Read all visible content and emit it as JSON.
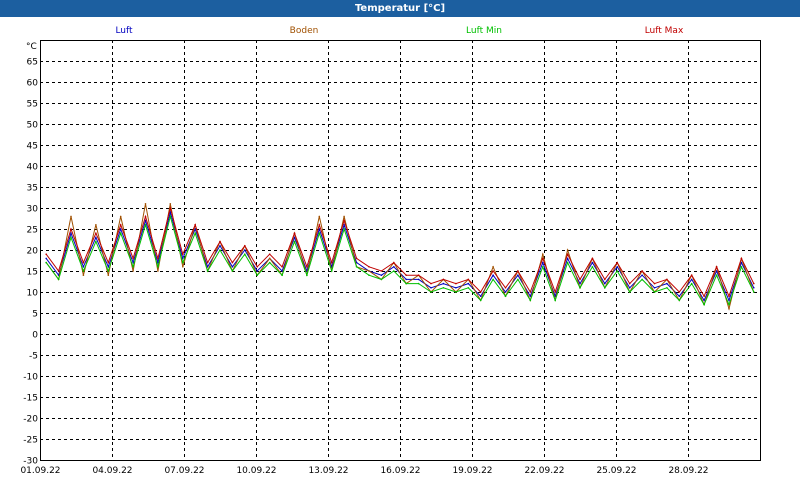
{
  "window": {
    "title": "Temperatur [°C]"
  },
  "chart_data": {
    "type": "line",
    "ylabel": "°C",
    "ylim": [
      -30,
      70
    ],
    "yticks": [
      65,
      60,
      55,
      50,
      45,
      40,
      35,
      30,
      25,
      20,
      15,
      10,
      5,
      0,
      -5,
      -10,
      -15,
      -20,
      -25,
      -30
    ],
    "xlim": [
      "01.09.22 00:00",
      "30.09.22 24:00"
    ],
    "xticks": [
      "01.09.22",
      "04.09.22",
      "07.09.22",
      "10.09.22",
      "13.09.22",
      "16.09.22",
      "19.09.22",
      "22.09.22",
      "25.09.22",
      "28.09.22"
    ],
    "grid": true,
    "legend_position": "top",
    "series": [
      {
        "name": "Luft",
        "color": "#0000c0",
        "values": [
          18,
          14,
          24,
          16,
          23,
          16,
          25,
          17,
          27,
          17,
          29,
          18,
          25,
          16,
          21,
          16,
          20,
          15,
          18,
          15,
          23,
          15,
          25,
          16,
          26,
          17,
          15,
          14,
          16,
          13,
          13,
          11,
          12,
          11,
          12,
          9,
          14,
          10,
          14,
          9,
          17,
          9,
          18,
          12,
          17,
          12,
          16,
          11,
          14,
          11,
          12,
          9,
          13,
          8,
          15,
          8,
          17,
          11
        ]
      },
      {
        "name": "Boden",
        "color": "#a05000",
        "values": [
          17,
          13,
          28,
          14,
          26,
          14,
          28,
          15,
          31,
          15,
          31,
          16,
          26,
          15,
          22,
          15,
          21,
          14,
          18,
          14,
          24,
          14,
          28,
          15,
          28,
          16,
          15,
          13,
          17,
          12,
          14,
          10,
          13,
          10,
          13,
          8,
          16,
          9,
          15,
          8,
          19,
          8,
          20,
          11,
          18,
          11,
          17,
          10,
          15,
          10,
          13,
          8,
          14,
          7,
          16,
          6,
          18,
          10
        ]
      },
      {
        "name": "Luft Min",
        "color": "#00c000",
        "values": [
          17,
          13,
          23,
          15,
          22,
          15,
          24,
          16,
          26,
          16,
          28,
          17,
          24,
          15,
          20,
          15,
          19,
          14,
          17,
          14,
          22,
          14,
          24,
          15,
          25,
          16,
          14,
          13,
          15,
          12,
          12,
          10,
          11,
          10,
          11,
          8,
          13,
          9,
          13,
          8,
          16,
          8,
          17,
          11,
          16,
          11,
          15,
          10,
          13,
          10,
          11,
          8,
          12,
          7,
          14,
          7,
          16,
          10
        ]
      },
      {
        "name": "Luft Max",
        "color": "#c00000",
        "values": [
          19,
          15,
          25,
          17,
          24,
          17,
          26,
          18,
          28,
          18,
          30,
          19,
          26,
          17,
          22,
          17,
          21,
          16,
          19,
          16,
          24,
          16,
          26,
          17,
          27,
          18,
          16,
          15,
          17,
          14,
          14,
          12,
          13,
          12,
          13,
          10,
          15,
          11,
          15,
          10,
          18,
          10,
          19,
          13,
          18,
          13,
          17,
          12,
          15,
          12,
          13,
          10,
          14,
          9,
          16,
          9,
          18,
          12
        ]
      }
    ]
  }
}
